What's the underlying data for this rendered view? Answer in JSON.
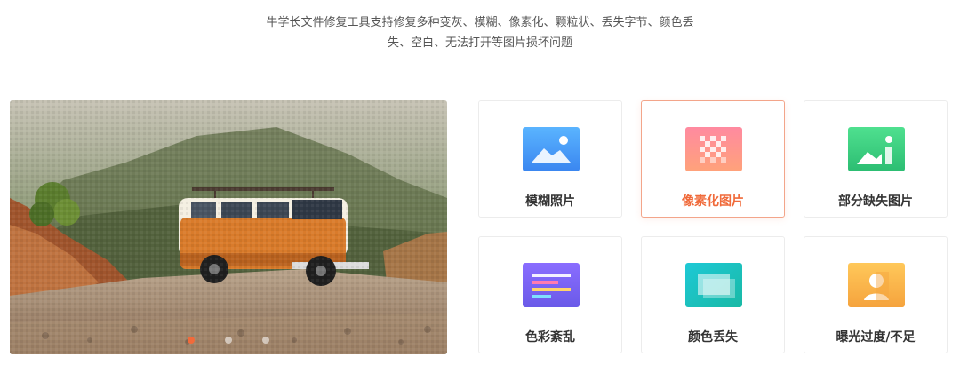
{
  "description": {
    "line1": "牛学长文件修复工具支持修复多种变灰、模糊、像素化、颗粒状、丢失字节、颜色丢",
    "line2": "失、空白、无法打开等图片损坏问题"
  },
  "carousel": {
    "slide_count": 3,
    "active_index": 0
  },
  "cards": [
    {
      "label": "模糊照片",
      "icon": "landscape-photo-icon",
      "color": "#4f9ff5"
    },
    {
      "label": "像素化图片",
      "icon": "pixelated-image-icon",
      "color": "#fb8a8a",
      "active": true
    },
    {
      "label": "部分缺失图片",
      "icon": "partial-missing-image-icon",
      "color": "#3fcf86"
    },
    {
      "label": "色彩紊乱",
      "icon": "color-disorder-icon",
      "color": "#7a6cf0"
    },
    {
      "label": "颜色丢失",
      "icon": "color-lost-icon",
      "color": "#22c7c4"
    },
    {
      "label": "曝光过度/不足",
      "icon": "exposure-icon",
      "color": "#f7b54a"
    }
  ],
  "theme": {
    "accent": "#f06a3a"
  }
}
